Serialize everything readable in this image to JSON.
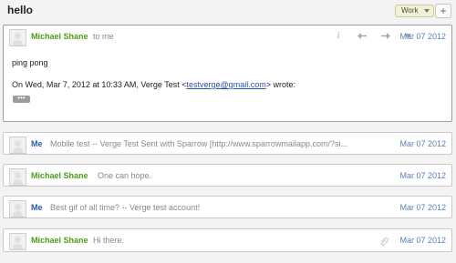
{
  "thread": {
    "subject": "hello",
    "label": "Work",
    "add_label_symbol": "+"
  },
  "messages": [
    {
      "sender": "Michael Shane",
      "recipient": "to me",
      "date": "Mar 07 2012",
      "body_line1": "ping pong",
      "quote_prefix": "On Wed, Mar 7, 2012 at 10:33 AM, Verge Test <",
      "quote_email": "testverge@gmail.com",
      "quote_suffix": "> wrote:",
      "show_trimmed_label": "•••",
      "icons": [
        "info-icon",
        "reply-icon",
        "forward-icon",
        "menu-chevron-icon"
      ]
    },
    {
      "sender": "Me",
      "snippet": "Mobile test  --  Verge Test Sent with Sparrow [http://www.sparrowmailapp.com/?si...",
      "date": "Mar 07 2012"
    },
    {
      "sender": "Michael Shane",
      "snippet": "One can hope.",
      "date": "Mar 07 2012"
    },
    {
      "sender": "Me",
      "snippet": "Best gif of all time?  --  Verge test account!",
      "date": "Mar 07 2012"
    },
    {
      "sender": "Michael Shane",
      "snippet": "Hi there.",
      "date": "Mar 07 2012",
      "has_attachment": true
    }
  ],
  "colors": {
    "sender_other": "#4e9a1a",
    "sender_me": "#2c5aa8",
    "date": "#5a7fb8"
  }
}
